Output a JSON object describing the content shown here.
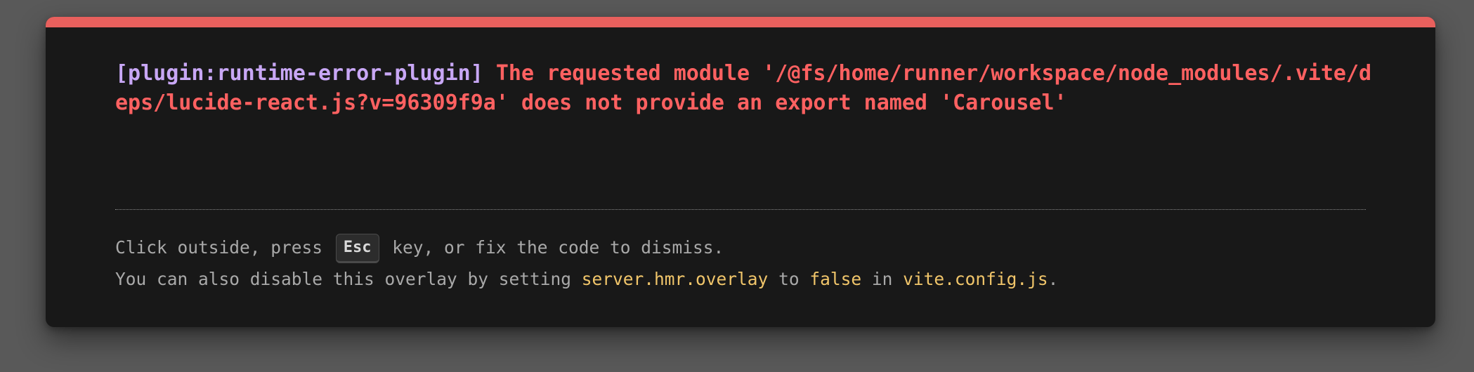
{
  "error": {
    "plugin": "[plugin:runtime-error-plugin]",
    "message": "The requested module '/@fs/home/runner/workspace/node_modules/.vite/deps/lucide-react.js?v=96309f9a' does not provide an export named 'Carousel'"
  },
  "tip": {
    "line1_before": "Click outside, press",
    "key": "Esc",
    "line1_after": "key, or fix the code to dismiss.",
    "line2_before": "You can also disable this overlay by setting",
    "setting": "server.hmr.overlay",
    "line2_to": "to",
    "value": "false",
    "line2_in": "in",
    "file": "vite.config.js",
    "line2_end": "."
  },
  "colors": {
    "accent": "#e8605d",
    "plugin": "#c8a7f5",
    "error": "#ff6161",
    "code": "#f0c56a",
    "background": "#181818"
  }
}
